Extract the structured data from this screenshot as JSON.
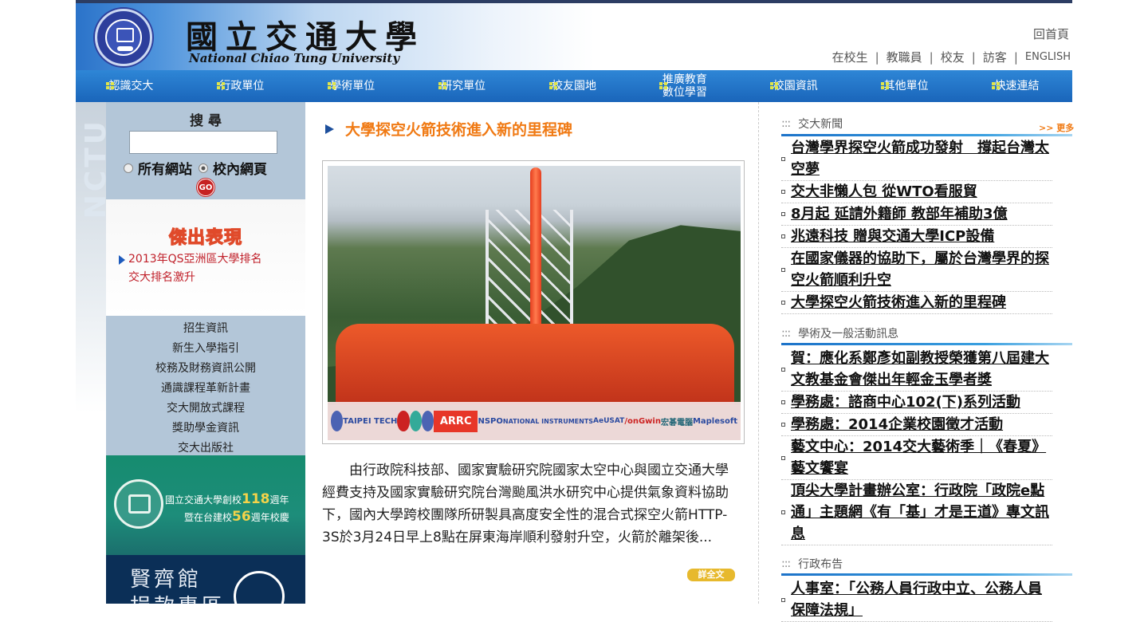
{
  "header": {
    "name_zh": "國立交通大學",
    "name_en": "National Chiao Tung University",
    "home": "回首頁",
    "audiences": [
      "在校生",
      "教職員",
      "校友",
      "訪客"
    ],
    "english": "ENGLISH"
  },
  "nav": [
    "認識交大",
    "行政單位",
    "學術單位",
    "研究單位",
    "校友園地",
    "推廣教育\n數位學習",
    "校園資訊",
    "其他單位",
    "快速連結"
  ],
  "sidebar": {
    "side_label": "NCTU",
    "search": {
      "title": "搜 尋",
      "input_value": "",
      "opt_all": "所有網站",
      "opt_site": "校內網頁",
      "go": "GO"
    },
    "award": {
      "title": "傑出表現",
      "link": "2013年QS亞洲區大學排名\n交大排名激升"
    },
    "links": [
      "招生資訊",
      "新生入學指引",
      "校務及財務資訊公開",
      "通識課程革新計畫",
      "交大開放式課程",
      "獎助學金資訊",
      "交大出版社"
    ],
    "anniversary": {
      "prefix1": "國立交通大學創校",
      "num1": "118",
      "suffix1": "週年",
      "prefix2": "暨在台建校",
      "num2": "56",
      "suffix2": "週年校慶"
    },
    "hall": "賢齊館\n捐款專區"
  },
  "feature": {
    "title": "大學探空火箭技術進入新的里程碑",
    "sponsors": [
      "TAIPEI TECH",
      "ARRC",
      "NSPO",
      "NATIONAL INSTRUMENTS",
      "AeUSAT",
      "/onGwin",
      "宏碁電腦",
      "Maplesoft"
    ],
    "body": "由行政院科技部、國家實驗研究院國家太空中心與國立交通大學經費支持及國家實驗研究院台灣颱風洪水研究中心提供氣象資料協助下，國內大學跨校團隊所研製具高度安全性的混合式探空火箭HTTP-3S於3月24日早上8點在屏東海岸順利發射升空，火箭於離架後...",
    "more": "詳全文"
  },
  "news": {
    "title": "交大新聞",
    "more": ">> 更多",
    "items": [
      "台灣學界探空火箭成功發射　撐起台灣太空夢",
      "交大非懶人包 從WTO看服貿",
      "8月起 延請外籍師 教部年補助3億",
      "兆遠科技 贈與交通大學ICP設備",
      "在國家儀器的協助下，屬於台灣學界的探空火箭順利升空",
      "大學探空火箭技術進入新的里程碑"
    ]
  },
  "events": {
    "title": "學術及一般活動訊息",
    "items": [
      "賀：應化系鄭彥如副教授榮獲第八屆建大文教基金會傑出年輕金玉學者獎",
      "學務處：諮商中心102(下)系列活動",
      "學務處：2014企業校園徵才活動",
      "藝文中心：2014交大藝術季｜《春夏》藝文饗宴",
      "頂尖大學計畫辦公室：行政院「政院e點通」主題網《有「基」才是王道》專文訊息"
    ]
  },
  "admin": {
    "title": "行政布告",
    "items": [
      "人事室：「公務人員行政中立、公務人員保障法規」"
    ]
  }
}
